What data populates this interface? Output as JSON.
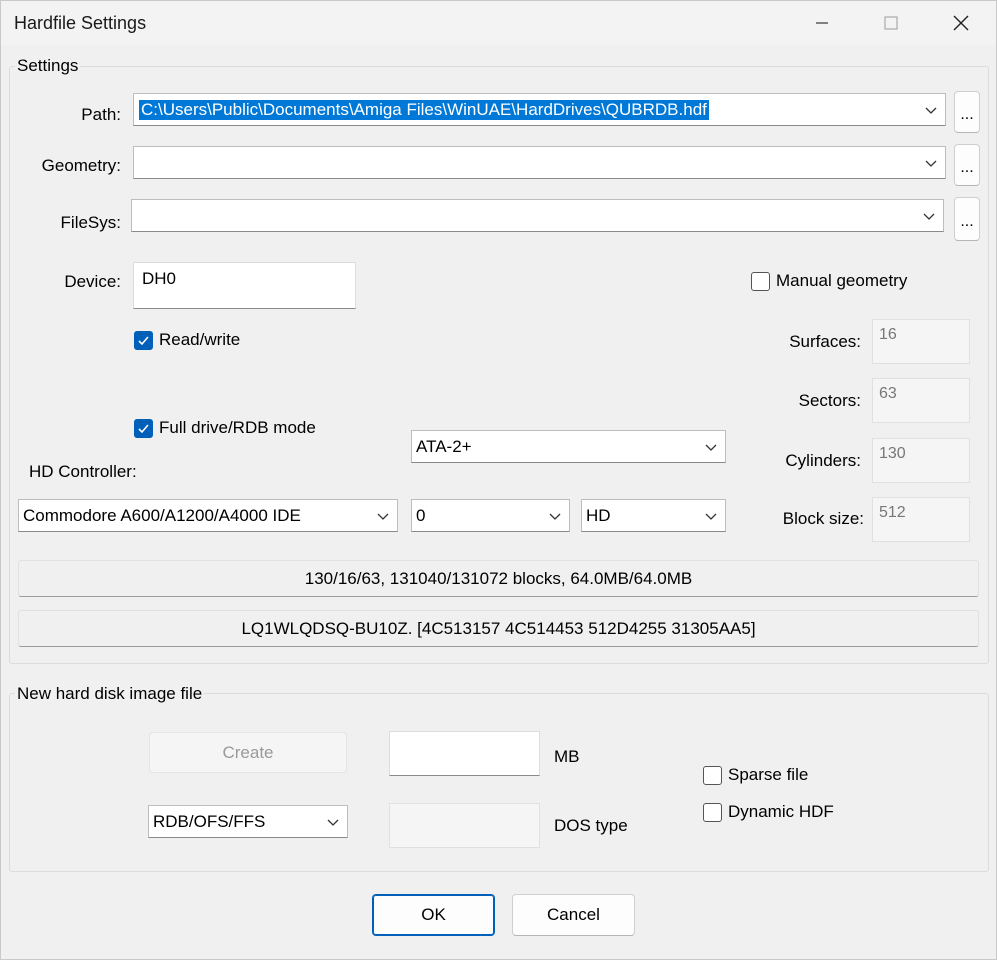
{
  "window": {
    "title": "Hardfile Settings"
  },
  "settings": {
    "group_label": "Settings",
    "path_label": "Path:",
    "path_value": "C:\\Users\\Public\\Documents\\Amiga Files\\WinUAE\\HardDrives\\QUBRDB.hdf",
    "geometry_label": "Geometry:",
    "geometry_value": "",
    "filesys_label": "FileSys:",
    "filesys_value": "",
    "browse_label": "...",
    "device_label": "Device:",
    "device_value": "DH0",
    "readwrite_label": "Read/write",
    "readwrite_checked": true,
    "fulldrive_label": "Full drive/RDB mode",
    "fulldrive_checked": true,
    "manual_geometry_label": "Manual geometry",
    "manual_geometry_checked": false,
    "surfaces_label": "Surfaces:",
    "surfaces_value": "16",
    "sectors_label": "Sectors:",
    "sectors_value": "63",
    "cylinders_label": "Cylinders:",
    "cylinders_value": "130",
    "blocksize_label": "Block size:",
    "blocksize_value": "512",
    "ata_value": "ATA-2+",
    "hd_controller_label": "HD Controller:",
    "controller_value": "Commodore A600/A1200/A4000 IDE",
    "unit_value": "0",
    "type_value": "HD",
    "info_geometry": "130/16/63, 131040/131072 blocks, 64.0MB/64.0MB",
    "info_id": "LQ1WLQDSQ-BU10Z. [4C513157 4C514453 512D4255 31305AA5]"
  },
  "new_image": {
    "group_label": "New hard disk image file",
    "create_label": "Create",
    "size_value": "",
    "mb_label": "MB",
    "format_value": "RDB/OFS/FFS",
    "dostype_value": "",
    "dostype_label": "DOS type",
    "sparse_label": "Sparse file",
    "sparse_checked": false,
    "dynamic_label": "Dynamic HDF",
    "dynamic_checked": false
  },
  "footer": {
    "ok_label": "OK",
    "cancel_label": "Cancel"
  },
  "colors": {
    "accent": "#005fb8",
    "selection": "#0078d7"
  }
}
